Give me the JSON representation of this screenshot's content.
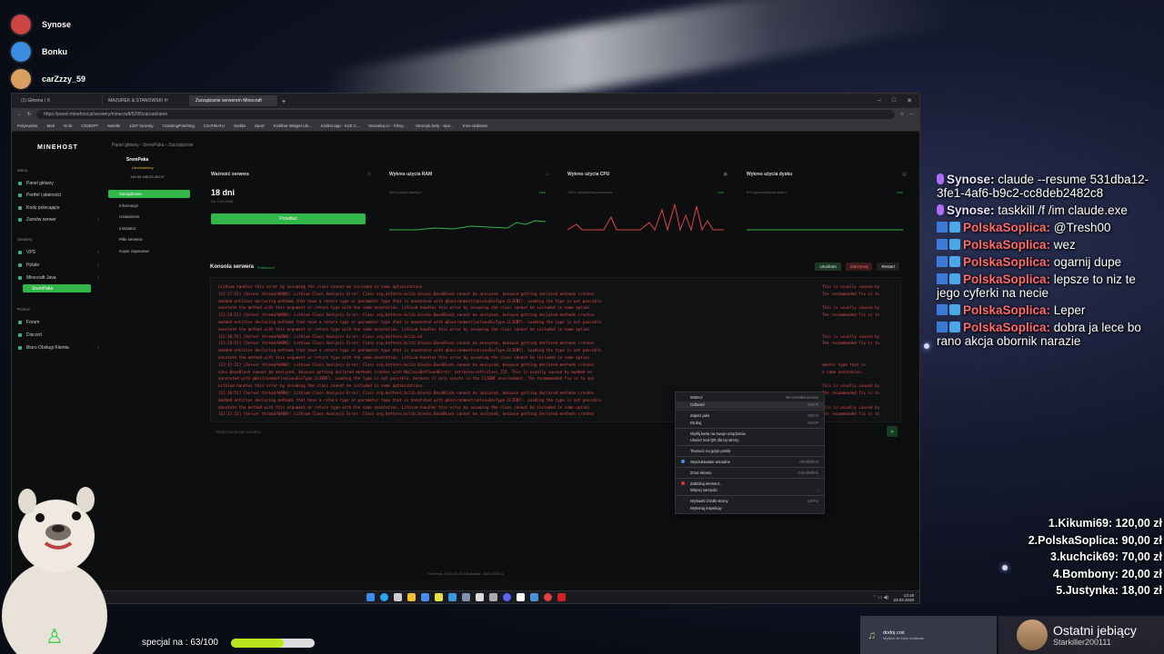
{
  "voice_users": [
    {
      "name": "Synose",
      "color": "#c44"
    },
    {
      "name": "Bonku",
      "color": "#3a8de0"
    },
    {
      "name": "carZzzy_59",
      "color": "#d9a060"
    }
  ],
  "browser": {
    "tabs": [
      "(1) Główna / X",
      "MAZUREK & STANOWSKI #!",
      "Zarządzanie serwerem Minecraft"
    ],
    "url": "https://panel.minehost.pl/serwery/minecraft/5295/zarzadzanie",
    "bookmarks": [
      "Polymarket",
      "Mail",
      "Grok",
      "ChatGPT",
      "Netelki",
      "1337 torrenty",
      "CrackingPatching",
      "CS.RIN.RU",
      "Giełda",
      "Sport",
      "Kicklbot Widget Lib...",
      "Kicklet.app - Kick C...",
      "Kinoteka.cc - Filmy...",
      "Strumyk.help - Spo...",
      "Inne ulubione"
    ]
  },
  "panel": {
    "logo": "MINEHOST",
    "breadcrumb": "Panel główny  ›  SremPaka  ›  Zarządzanie",
    "menu_head": "Menu",
    "menu": [
      "Panel główny",
      "Portfel i płatności",
      "Kody polecające",
      "Zamów serwer"
    ],
    "servers_head": "Serwery",
    "servers": [
      "VPS",
      "Hytale",
      "Minecraft Java"
    ],
    "active_server": "SremPaka",
    "help_head": "Pomoc",
    "help": [
      "Forum",
      "Discord",
      "Biuro Obsługi Klienta"
    ],
    "server_name": "SremPaka",
    "server_status": "Uruchomiony",
    "server_ip": "146.59.186.53:45137",
    "subnav": [
      "Zarządzanie",
      "Informacje",
      "Ustawienia",
      "Instalator",
      "Pliki serwera",
      "Kopie zapasowe"
    ],
    "cards": [
      {
        "title": "Ważność serwera",
        "value": "18 dni",
        "sub": "Do 7.04.2026",
        "button": "Przedłuż"
      },
      {
        "title": "Wykres użycia RAM",
        "sub": "26% użycia pamięci",
        "live": "Live"
      },
      {
        "title": "Wykres użycia CPU",
        "sub": "115% obciążenia procesora",
        "live": "Live"
      },
      {
        "title": "Wykres użycia dysku",
        "sub": "5% wykorzystania dysku",
        "live": "Live"
      }
    ],
    "console_title": "Konsola serwera",
    "console_status": "Połączono",
    "console_buttons": [
      "Uruchom",
      "Zatrzymaj",
      "Restart"
    ],
    "log": [
      "Lithium handles this error by assuming the class cannot be included in some optimizations.",
      "[12:17:21] [Server thread/WARN]: Lithium Class Analysis Error: Class org.bettere.bclib.blocks.BaseBlock cannot be analysed, because getting declared methods crashes",
      "modded entities declaring methods that have a return type or parameter type that is annotated with @Environment(value=EnvType.CLIENT). Loading the type is not possible",
      "annotate the method with this argument or return type with the same annotation. Lithium handles this error by assuming the class cannot be included in some optimi",
      "[12:18:51] [Server thread/WARN]: Lithium Class Analysis Error: Class org.bettere.bclib.blocks.BaseBlock cannot be analysed, because getting declared methods crashes",
      "modded entities declaring methods that have a return type or parameter type that is annotated with @Environment(value=EnvType.CLIENT). Loading the type is not possible",
      "annotate the method with this argument or return type with the same annotation. Lithium handles this error by assuming the class cannot be included in some optimi",
      "[12:18:51] [Server thread/WARN]: Lithium Class Analysis Error: Class org.bettere.bclib.b3",
      "[12:18:51] [Server thread/WARN]: Lithium Class Analysis Error: Class org.bettere.bclib.blocks.BaseBlock cannot be analysed, because getting declared methods crashes",
      "modded entities declaring methods that have a return type or parameter type that is annotated with @Environment(value=EnvType.CLIENT). Loading the type is not possible",
      "annotate the method with this argument or return type with the same annotation. Lithium handles this error by assuming the class cannot be included in some optimi",
      "[12:17:21] [Server thread/WARN]: Lithium Class Analysis Error: Class org.bettere.bclib.blocks.BaseBlock cannot be analysed, because getting declared methods crashes",
      "ocks.BaseBlock cannot be analysed, because getting declared methods crashes with NoClassDefFoundError: net/minecraft/class_715. This is usually caused by modded en",
      "annotated with @Environment(value=EnvType.CLIENT). Loading the type is not possible, because it only exists in the CLIENT environment. The recommended fix is to ann",
      "Lithium handles this error by assuming the class cannot be included in some optimizations.",
      "[12:18:51] [Server thread/WARN]: Lithium Class Analysis Error: Class org.bettere.bclib.blocks.BaseBlock cannot be analysed, because getting declared methods crashes",
      "modded entities declaring methods that have a return type or parameter type that is annotated with @Environment(value=EnvType.CLIENT). Loading the type is not possible",
      "annotate the method with this argument or return type with the same annotation. Lithium handles this error by assuming the class cannot be included in some optimi",
      "[12:17:21] [Server thread/WARN]: Lithium Class Analysis Error: Class org.bettere.bclib.blocks.BaseBlock cannot be analysed, because getting declared methods crashes"
    ],
    "log_right": [
      "This is usually caused by",
      "The recommended fix is to",
      "",
      "This is usually caused by",
      "The recommended fix is to",
      "",
      "",
      "This is usually caused by",
      "The recommended fix is to",
      "",
      "",
      "ameter type that is",
      "e same annotation.",
      "",
      "This is usually caused by",
      "The recommended fix is to",
      "",
      "This is usually caused by",
      "The recommended fix is to"
    ],
    "command_placeholder": "Wpisz komendę serwera...",
    "footer": "Frontend: 2026.03.16.2    Backend: 2026.03.02.1"
  },
  "context_menu": [
    {
      "label": "Wstecz",
      "shortcut": "Alt+Strzałka w lewo"
    },
    {
      "label": "Odśwież",
      "shortcut": "Ctrl+R",
      "highlight": true
    },
    {
      "sep": true
    },
    {
      "label": "Zapisz jako",
      "shortcut": "Ctrl+S"
    },
    {
      "label": "Drukuj",
      "shortcut": "Ctrl+P"
    },
    {
      "sep": true
    },
    {
      "label": "Wyślij kartę na swoje urządzenia",
      "shortcut": ""
    },
    {
      "label": "Utwórz kod QR dla tej strony",
      "shortcut": ""
    },
    {
      "sep": true
    },
    {
      "label": "Tłumacz na język polski",
      "shortcut": ""
    },
    {
      "sep": true
    },
    {
      "label": "Wyszukiwanie wizualne",
      "shortcut": "Alt+Shift+S",
      "icon": "#4a8df0"
    },
    {
      "sep": true
    },
    {
      "label": "Zrzut ekranu",
      "shortcut": "Ctrl+Shift+S"
    },
    {
      "sep": true
    },
    {
      "label": "Zablokuj element...",
      "shortcut": "",
      "icon": "#d33"
    },
    {
      "label": "Więcej narzędzi",
      "shortcut": "›"
    },
    {
      "sep": true
    },
    {
      "label": "Wyświetl źródło strony",
      "shortcut": "Ctrl+U"
    },
    {
      "label": "Wykonaj inspekcję",
      "shortcut": ""
    }
  ],
  "taskbar": {
    "time": "13:18",
    "date": "23.03.2026"
  },
  "chat": [
    {
      "name": "Synose",
      "text": "claude --resume 531dba12-3fe1-4af6-b9c2-cc8deb2482c8",
      "color": "#e8e0ff",
      "mic": true
    },
    {
      "name": "Synose",
      "text": "taskkill /f /im claude.exe",
      "color": "#e8e0ff",
      "mic": true
    },
    {
      "name": "PolskaSoplica",
      "text": "@Tresh00",
      "color": "#ff6a6a"
    },
    {
      "name": "PolskaSoplica",
      "text": "wez",
      "color": "#ff6a6a"
    },
    {
      "name": "PolskaSoplica",
      "text": "ogarnij dupe",
      "color": "#ff6a6a"
    },
    {
      "name": "PolskaSoplica",
      "text": "lepsze to niz te jego cyferki na necie",
      "color": "#ff6a6a"
    },
    {
      "name": "PolskaSoplica",
      "text": "Leper",
      "color": "#ff6a6a"
    },
    {
      "name": "PolskaSoplica",
      "text": "dobra ja lece bo rano akcja obornik narazie",
      "color": "#ff6a6a"
    }
  ],
  "leaderboard": [
    "1.Kikumi69: 120,00 zł",
    "2.PolskaSoplica: 90,00 zł",
    "3.kuchcik69: 70,00 zł",
    "4.Bombony: 20,00 zł",
    "5.Justynka: 18,00 zł"
  ],
  "music": {
    "title": "dodoj coś",
    "sub": "Myślisz że lubię dodawać"
  },
  "last_donor": {
    "title": "Ostatni jebiący",
    "name": "Starkiller200111"
  },
  "goal": {
    "label": "specjal na : 63/100",
    "fraction": 0.63
  }
}
